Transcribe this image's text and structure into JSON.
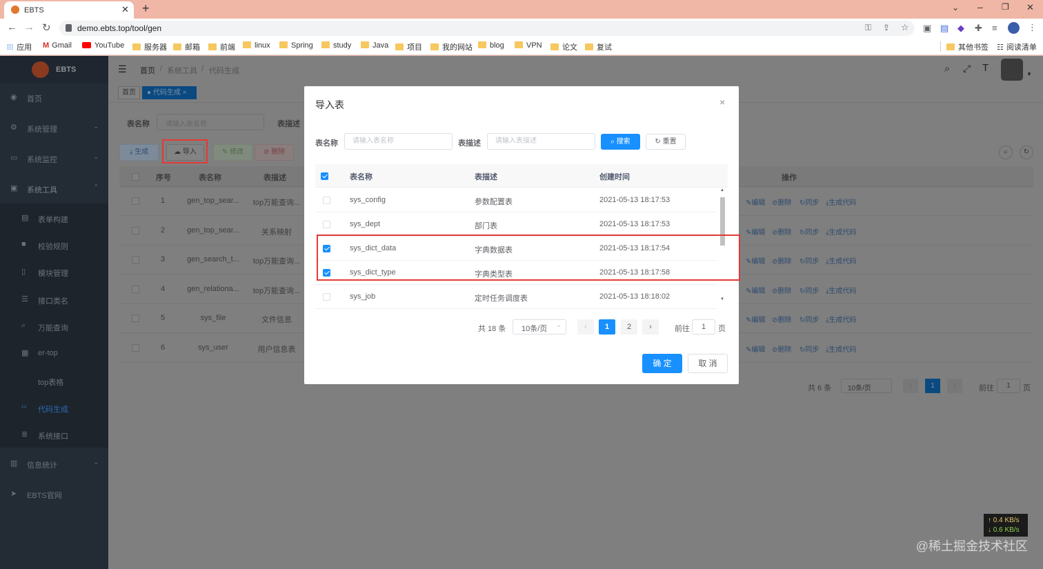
{
  "browser": {
    "tab_title": "EBTS",
    "url": "demo.ebts.top/tool/gen",
    "bookmarks": [
      "应用",
      "Gmail",
      "YouTube",
      "服务器",
      "邮箱",
      "前端",
      "linux",
      "Spring",
      "study",
      "Java",
      "项目",
      "我的网站",
      "blog",
      "VPN",
      "论文",
      "复试"
    ],
    "bookmarks_right": [
      "其他书签",
      "阅读清单"
    ]
  },
  "sidebar": {
    "logo": "EBTS",
    "items": [
      {
        "label": "首页"
      },
      {
        "label": "系统管理"
      },
      {
        "label": "系统监控"
      },
      {
        "label": "系统工具"
      },
      {
        "label": "表单构建"
      },
      {
        "label": "校验规则"
      },
      {
        "label": "模块管理"
      },
      {
        "label": "接口类名"
      },
      {
        "label": "万能查询"
      },
      {
        "label": "er-top"
      },
      {
        "label": "top表格"
      },
      {
        "label": "代码生成"
      },
      {
        "label": "系统接口"
      },
      {
        "label": "信息统计"
      },
      {
        "label": "EBTS官网"
      }
    ]
  },
  "header": {
    "breadcrumb": [
      "首页",
      "系统工具",
      "代码生成"
    ]
  },
  "tags": {
    "home": "首页",
    "active": "代码生成"
  },
  "background": {
    "search_label": "表名称",
    "search_placeholder": "请输入表名称",
    "desc_label": "表描述",
    "buttons": [
      "生成",
      "导入",
      "修改",
      "删除"
    ],
    "columns": [
      "序号",
      "表名称",
      "表描述"
    ],
    "ops_header": "操作",
    "rows": [
      {
        "no": "1",
        "name": "gen_top_sear...",
        "desc": "top万能查询..."
      },
      {
        "no": "2",
        "name": "gen_top_sear...",
        "desc": "关系映射"
      },
      {
        "no": "3",
        "name": "gen_search_t...",
        "desc": "top万能查询..."
      },
      {
        "no": "4",
        "name": "gen_relationa...",
        "desc": "top万能查询..."
      },
      {
        "no": "5",
        "name": "sys_file",
        "desc": "文件信息"
      },
      {
        "no": "6",
        "name": "sys_user",
        "desc": "用户信息表"
      }
    ],
    "row_actions": [
      "编辑",
      "删除",
      "同步",
      "生成代码"
    ],
    "pager": {
      "total": "共 6 条",
      "size": "10条/页",
      "page": "1",
      "goto": "前往",
      "goto_value": "1",
      "page_unit": "页"
    }
  },
  "modal": {
    "title": "导入表",
    "name_label": "表名称",
    "name_placeholder": "请输入表名称",
    "desc_label": "表描述",
    "desc_placeholder": "请输入表描述",
    "search_btn": "搜索",
    "reset_btn": "重置",
    "columns": [
      "表名称",
      "表描述",
      "创建时间"
    ],
    "rows": [
      {
        "name": "sys_config",
        "desc": "参数配置表",
        "time": "2021-05-13 18:17:53",
        "checked": false
      },
      {
        "name": "sys_dept",
        "desc": "部门表",
        "time": "2021-05-13 18:17:53",
        "checked": false
      },
      {
        "name": "sys_dict_data",
        "desc": "字典数据表",
        "time": "2021-05-13 18:17:54",
        "checked": true
      },
      {
        "name": "sys_dict_type",
        "desc": "字典类型表",
        "time": "2021-05-13 18:17:58",
        "checked": true
      },
      {
        "name": "sys_job",
        "desc": "定时任务调度表",
        "time": "2021-05-13 18:18:02",
        "checked": false
      }
    ],
    "pager": {
      "total": "共 18 条",
      "size": "10条/页",
      "pages": [
        "1",
        "2"
      ],
      "goto": "前往",
      "goto_value": "1",
      "page_unit": "页"
    },
    "confirm_btn": "确 定",
    "cancel_btn": "取 消"
  },
  "overlay": {
    "watermark": "@稀土掘金技术社区",
    "net_up": "↑ 0.4 KB/s",
    "net_down": "↓ 0.6 KB/s"
  },
  "colors": {
    "primary": "#1890ff",
    "highlight": "#e53935",
    "sidebar": "#232b35"
  }
}
